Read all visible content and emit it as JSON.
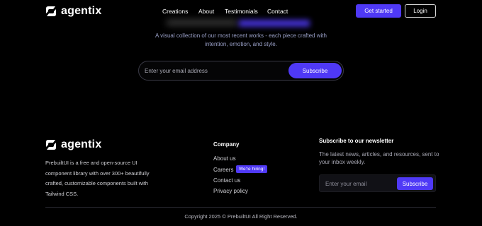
{
  "brand": {
    "name": "agentix"
  },
  "nav": {
    "links": [
      "Creations",
      "About",
      "Testimonials",
      "Contact"
    ]
  },
  "header": {
    "get_started": "Get started",
    "login": "Login"
  },
  "hero": {
    "subtitle_line1": "A visual collection of our most recent works - each piece crafted with",
    "subtitle_line2": "intention, emotion, and style.",
    "email_placeholder": "Enter your email address",
    "subscribe_label": "Subscribe"
  },
  "footer": {
    "description_lines": [
      "PrebuiltUI is a free and open-source UI",
      "component library with over 300+ beautifully",
      "crafted, customizable components built with",
      "Tailwind CSS."
    ],
    "company": {
      "title": "Company",
      "links": [
        "About us",
        "Careers",
        "Contact us",
        "Privacy policy"
      ],
      "hiring_badge": "We're hiring!"
    },
    "newsletter": {
      "title": "Subscribe to our newsletter",
      "desc_line1": "The latest news, articles, and resources, sent to",
      "desc_line2": "your inbox weekly.",
      "email_placeholder": "Enter your email",
      "subscribe_label": "Subscribe"
    },
    "copyright": "Copyright 2025 © PrebuiltUI All Right Reserved."
  },
  "colors": {
    "accent": "#4f39f6",
    "background": "#000000"
  }
}
